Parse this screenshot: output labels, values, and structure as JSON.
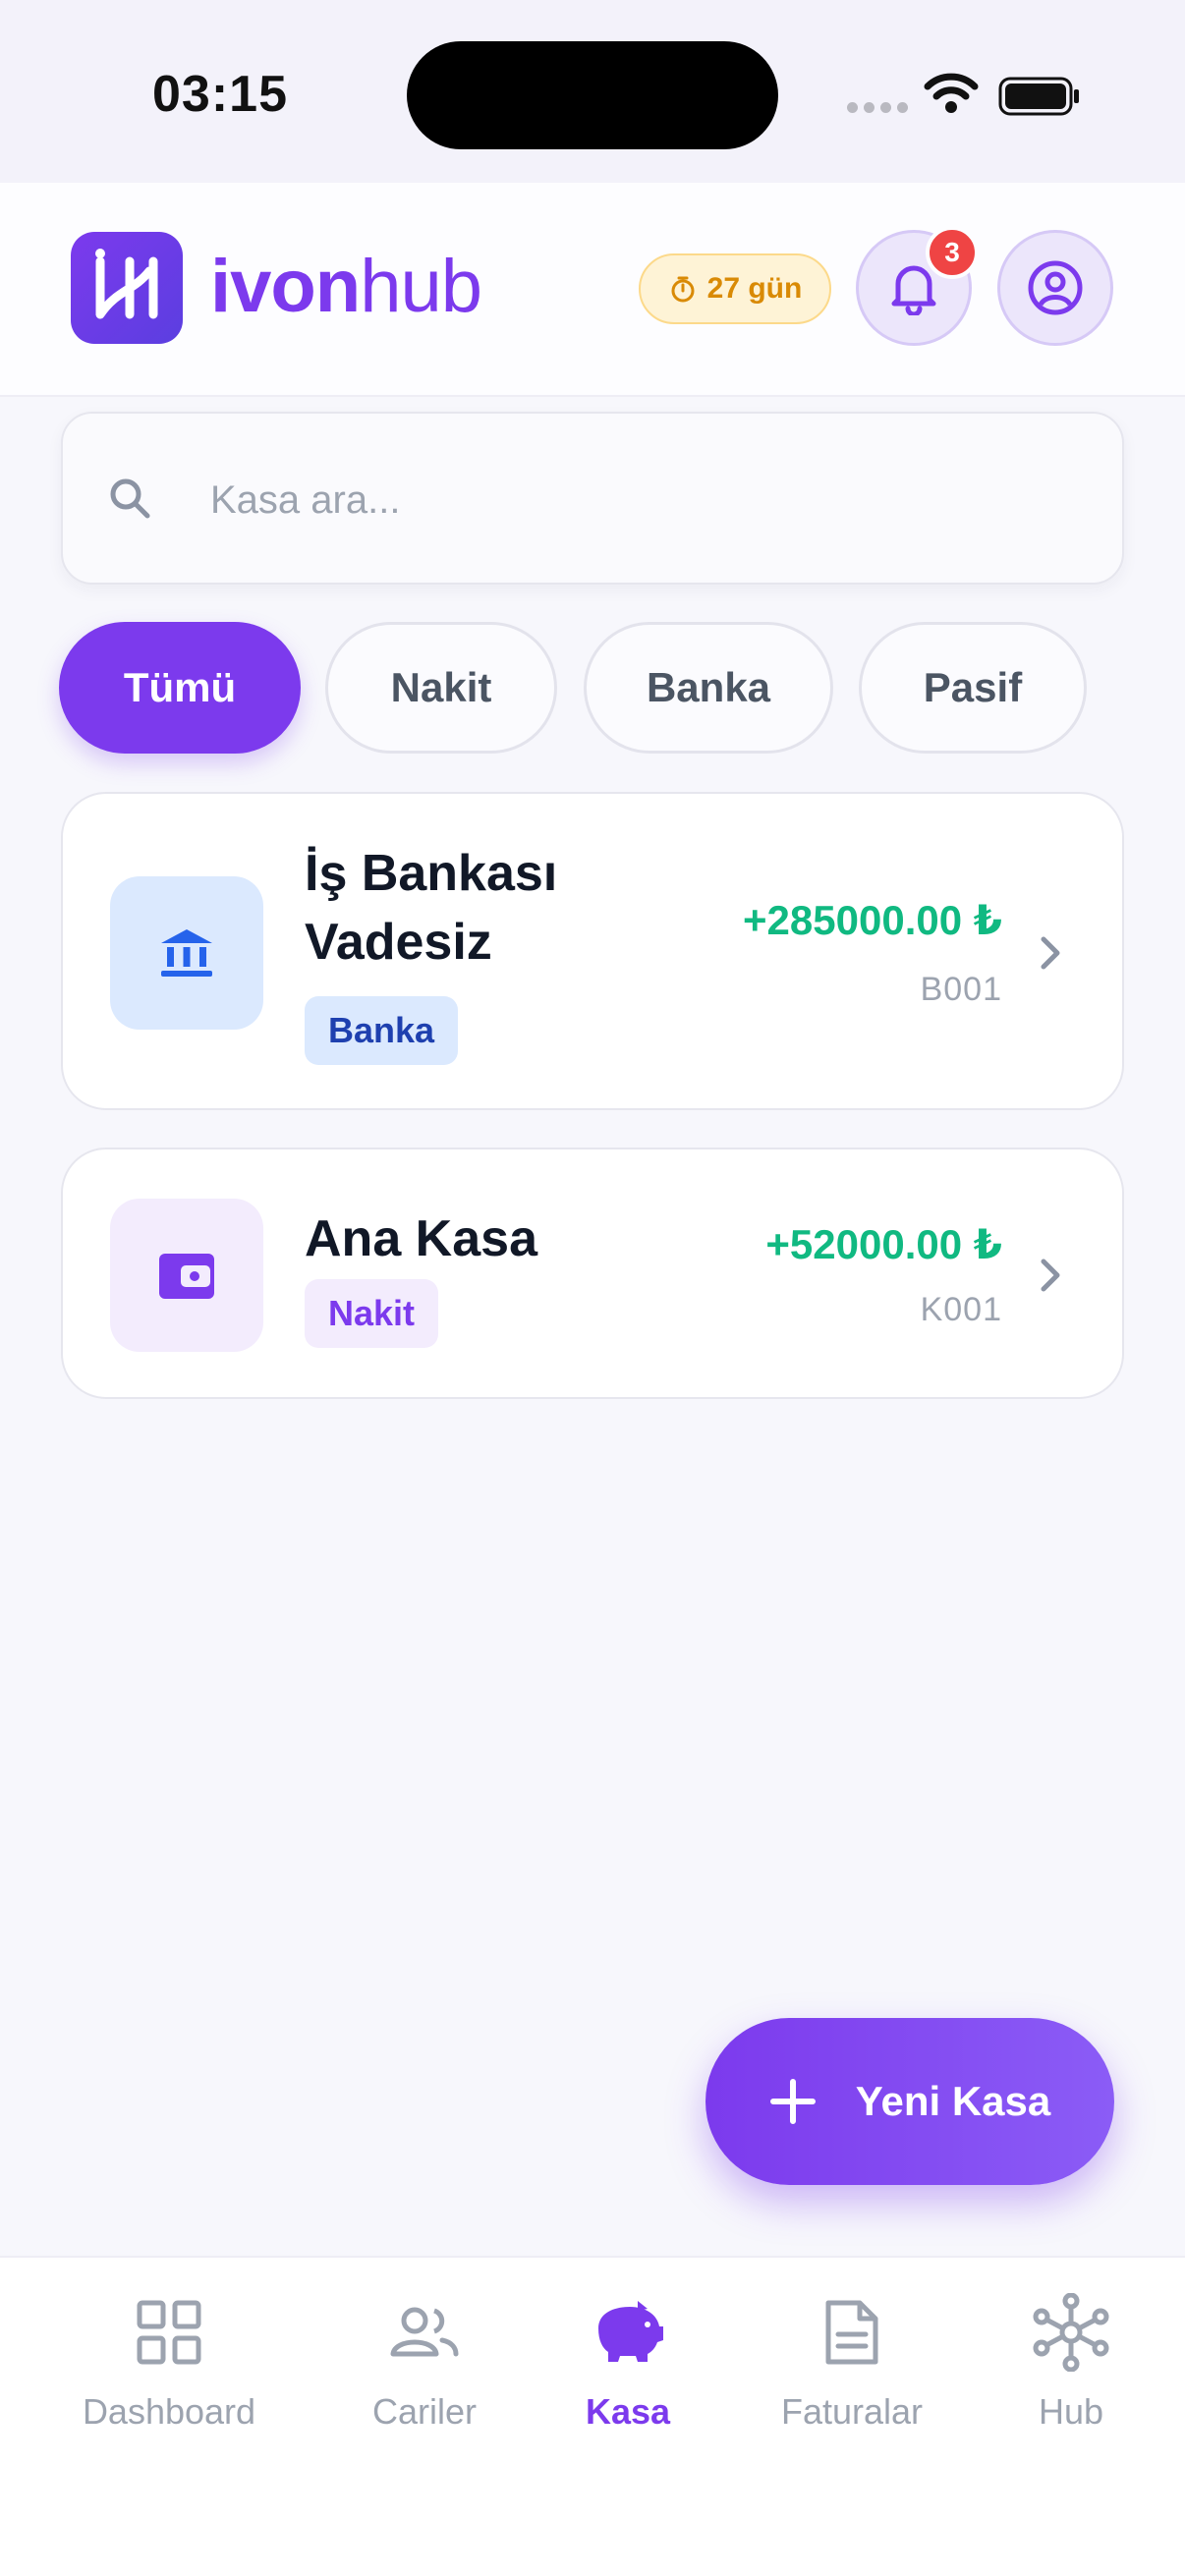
{
  "status_bar": {
    "time": "03:15"
  },
  "header": {
    "logo_bold": "ivon",
    "logo_light": "hub",
    "trial_badge": "27 gün",
    "notification_count": "3"
  },
  "search": {
    "placeholder": "Kasa ara..."
  },
  "filters": {
    "items": [
      {
        "label": "Tümü",
        "active": true
      },
      {
        "label": "Nakit",
        "active": false
      },
      {
        "label": "Banka",
        "active": false
      },
      {
        "label": "Pasif",
        "active": false
      }
    ]
  },
  "accounts": [
    {
      "name": "İş Bankası Vadesiz",
      "type": "Banka",
      "amount": "+285000.00 ₺",
      "code": "B001",
      "icon": "bank-icon"
    },
    {
      "name": "Ana Kasa",
      "type": "Nakit",
      "amount": "+52000.00 ₺",
      "code": "K001",
      "icon": "wallet-icon"
    }
  ],
  "fab": {
    "label": "Yeni Kasa"
  },
  "nav": {
    "items": [
      {
        "label": "Dashboard",
        "icon": "grid-icon",
        "active": false
      },
      {
        "label": "Cariler",
        "icon": "users-icon",
        "active": false
      },
      {
        "label": "Kasa",
        "icon": "piggy-bank-icon",
        "active": true
      },
      {
        "label": "Faturalar",
        "icon": "document-icon",
        "active": false
      },
      {
        "label": "Hub",
        "icon": "network-icon",
        "active": false
      }
    ]
  },
  "colors": {
    "accent": "#7c3aed",
    "positive": "#10b981",
    "bank_badge_bg": "#dbe9fe",
    "cash_badge_bg": "#f3ecfd",
    "warning": "#d98a05",
    "danger": "#ef4444"
  }
}
